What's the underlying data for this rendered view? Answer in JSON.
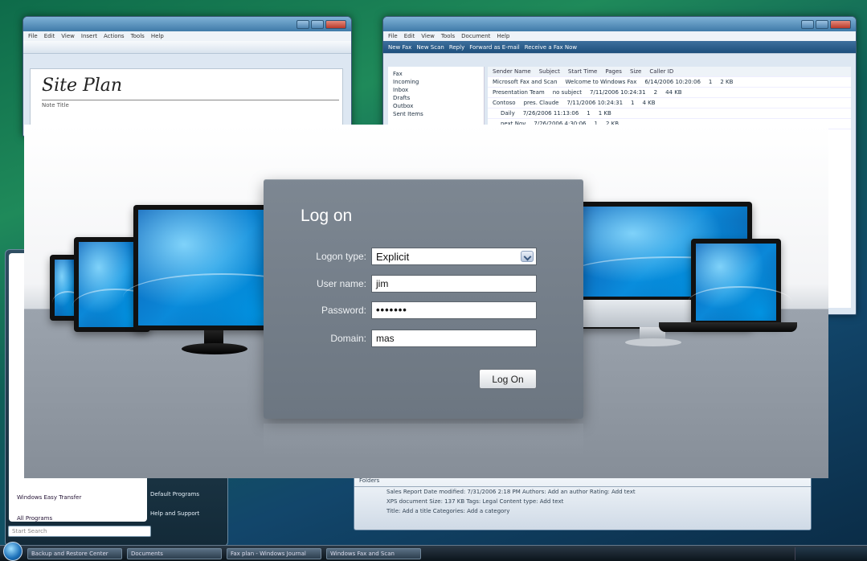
{
  "background": {
    "journal_window": {
      "menu": [
        "File",
        "Edit",
        "View",
        "Insert",
        "Actions",
        "Tools",
        "Help"
      ],
      "page_heading": "Site Plan",
      "note_title_label": "Note Title"
    },
    "fax_window": {
      "menu": [
        "File",
        "Edit",
        "View",
        "Tools",
        "Document",
        "Help"
      ],
      "toolbar": [
        "New Fax",
        "New Scan",
        "Reply",
        "Forward as E-mail",
        "Receive a Fax Now"
      ],
      "tree": [
        "Fax",
        "Incoming",
        "Inbox",
        "Drafts",
        "Outbox",
        "Sent Items"
      ],
      "columns": [
        "Sender Name",
        "Subject",
        "Start Time",
        "Pages",
        "Size",
        "Caller ID"
      ],
      "rows": [
        [
          "Microsoft Fax and Scan",
          "Welcome to Windows Fax",
          "6/14/2006 10:20:06",
          "1",
          "2 KB"
        ],
        [
          "Presentation Team",
          "no subject",
          "7/11/2006 10:24:31",
          "2",
          "44 KB"
        ],
        [
          "Contoso",
          "pres. Claude",
          "7/11/2006 10:24:31",
          "1",
          "4 KB"
        ],
        [
          "",
          "Daily",
          "7/26/2006 11:13:06",
          "1",
          "1 KB"
        ],
        [
          "",
          "next Nov",
          "7/26/2006 4:30:06",
          "1",
          "2 KB"
        ]
      ]
    },
    "start_menu": {
      "items": [
        "Windows Easy Transfer",
        "All Programs"
      ],
      "right_links": [
        "Default Programs",
        "Help and Support"
      ],
      "search_placeholder": "Start Search"
    },
    "details_pane": {
      "tab": "Folders",
      "line1": "Sales Report  Date modified: 7/31/2006 2:18 PM    Authors: Add an author    Rating: Add text",
      "line2": "XPS document   Size: 137 KB    Tags: Legal    Content type: Add text",
      "line3": "Title: Add a title    Categories: Add a category"
    },
    "taskbar": [
      "Backup and Restore Center",
      "Documents",
      "Fax plan - Windows Journal",
      "Windows Fax and Scan"
    ]
  },
  "login": {
    "title": "Log on",
    "logon_type_label": "Logon type:",
    "logon_type_value": "Explicit",
    "username_label": "User name:",
    "username_value": "jim",
    "password_label": "Password:",
    "password_value": "•••••••",
    "domain_label": "Domain:",
    "domain_value": "mas",
    "logon_button": "Log On"
  }
}
